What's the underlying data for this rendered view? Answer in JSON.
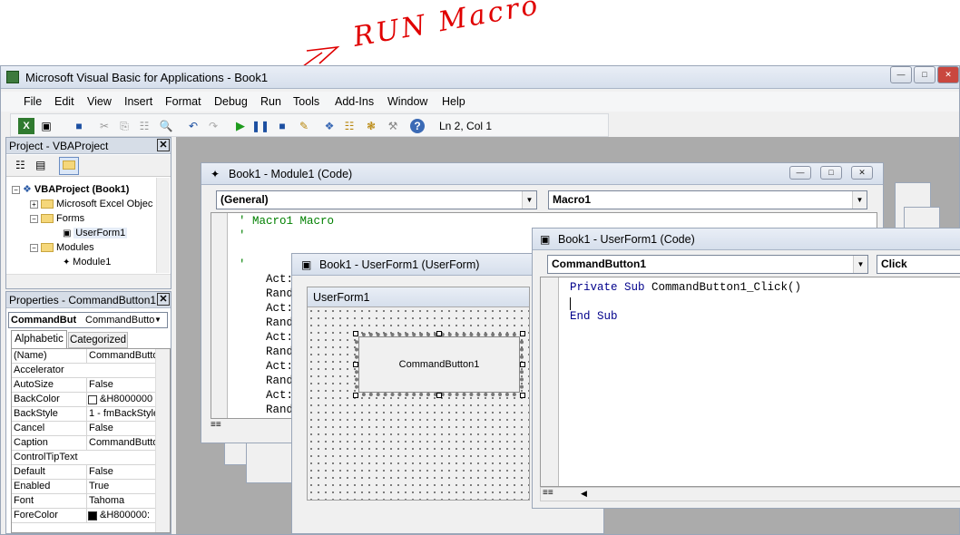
{
  "annotation_text": "RUN Macro",
  "app": {
    "title": "Microsoft Visual Basic for Applications - Book1"
  },
  "menu": [
    "File",
    "Edit",
    "View",
    "Insert",
    "Format",
    "Debug",
    "Run",
    "Tools",
    "Add-Ins",
    "Window",
    "Help"
  ],
  "toolbar": {
    "position": "Ln 2, Col 1"
  },
  "project": {
    "title": "Project - VBAProject",
    "root": "VBAProject (Book1)",
    "excel_objects": "Microsoft Excel Objec",
    "forms": "Forms",
    "userform": "UserForm1",
    "modules": "Modules",
    "module": "Module1"
  },
  "properties": {
    "title": "Properties - CommandButton1",
    "object_name": "CommandBut",
    "object_type": "CommandButto",
    "tab_alpha": "Alphabetic",
    "tab_cat": "Categorized",
    "rows": [
      [
        "(Name)",
        "CommandButto"
      ],
      [
        "Accelerator",
        ""
      ],
      [
        "AutoSize",
        "False"
      ],
      [
        "BackColor",
        "&H8000000"
      ],
      [
        "BackStyle",
        "1 - fmBackStyle"
      ],
      [
        "Cancel",
        "False"
      ],
      [
        "Caption",
        "CommandButto"
      ],
      [
        "ControlTipText",
        ""
      ],
      [
        "Default",
        "False"
      ],
      [
        "Enabled",
        "True"
      ],
      [
        "Font",
        "Tahoma"
      ],
      [
        "ForeColor",
        "&H800000:"
      ]
    ]
  },
  "module_win": {
    "title": "Book1 - Module1 (Code)",
    "left_combo": "(General)",
    "right_combo": "Macro1",
    "lines": [
      "' Macro1 Macro",
      "'",
      "",
      "'",
      "    Act:",
      "    Rand",
      "    Act:",
      "    Rand",
      "    Act:",
      "    Rand",
      "    Act:",
      "    Rand",
      "    Act:",
      "    Rand"
    ]
  },
  "userform_win": {
    "title": "Book1 - UserForm1 (UserForm)",
    "form_caption": "UserForm1",
    "button_caption": "CommandButton1"
  },
  "code_win": {
    "title": "Book1 - UserForm1 (Code)",
    "left_combo": "CommandButton1",
    "right_combo": "Click",
    "line1_kw": "Private Sub ",
    "line1_name": "CommandButton1_Click",
    "line1_tail": "()",
    "line3": "End Sub"
  },
  "colors": {
    "annotation": "#e00000",
    "keyword": "#00008b",
    "comment": "#008000"
  }
}
